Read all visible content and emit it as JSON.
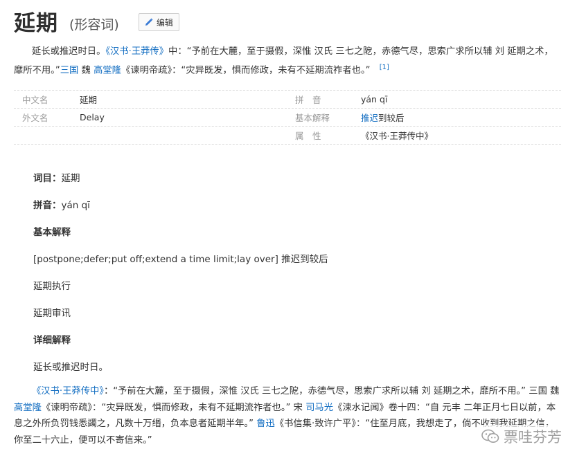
{
  "header": {
    "title": "延期",
    "subtitle": "(形容词)",
    "edit_label": "编辑"
  },
  "lead": {
    "p1": "延长或推迟时日。",
    "ref1_book": "《汉书·王莽传》",
    "p2": "中：“予前在大麓，至于摄假，深惟 汉氏 三七之阸，赤德气尽，思索广求所以辅 刘 延期之术，靡所不用。”",
    "ref2_dynasty": "三国",
    "p3": " 魏 ",
    "ref3_person": "高堂隆",
    "p4": "《谏明帝疏》：“灾异既发，惧而修政，未有不延期流祚者也。”",
    "citation": "[1]"
  },
  "basic_info": {
    "rows": [
      {
        "left_name": "中文名",
        "left_value": "延期",
        "right_name": "拼　音",
        "right_value": "yán qī"
      },
      {
        "left_name": "外文名",
        "left_value": "Delay",
        "right_name": "基本解释",
        "right_value_link": "推迟",
        "right_value_rest": "到较后"
      },
      {
        "left_name": "",
        "left_value": "",
        "right_name": "属　性",
        "right_value": "《汉书·王莽传中》"
      }
    ]
  },
  "entry": {
    "term_label": "词目：",
    "term_value": "延期",
    "pinyin_label": "拼音：",
    "pinyin_value": "yán qī",
    "basic_heading": "基本解释",
    "basic_def": "[postpone;defer;put off;extend a time limit;lay over] 推迟到较后",
    "example1": "延期执行",
    "example2": "延期审讯",
    "detail_heading": "详细解释",
    "detail_def": "延长或推迟时日。"
  },
  "detail_paragraph": {
    "s1_link": "《汉书·王莽传中》",
    "s1": "：“予前在大麓，至于摄假，深惟 汉氏 三七之阸，赤德气尽，思索广求所以辅 刘 延期之术，靡所不用。” 三国 魏 ",
    "s2_link": "高堂隆",
    "s2": "《谏明帝疏》：“灾异既发，惧而修政，未有不延期流祚者也。” 宋 ",
    "s3_link": "司马光",
    "s3": "《涑水记闻》卷十四：“自 元丰 二年正月七日以前，本息之外所负罚钱悉蠲之，凡数十万缗，负本息者延期半年。” ",
    "s4_link": "鲁迅",
    "s4": "《书信集·致许广平》：“住至月底，我想走了，倘不收到我延期之信，你至二十六止，便可以不寄信来。”"
  },
  "watermark": {
    "text": "票哇芬芳"
  },
  "colors": {
    "link": "#136ec2",
    "label_gray": "#999999",
    "text": "#333333"
  }
}
